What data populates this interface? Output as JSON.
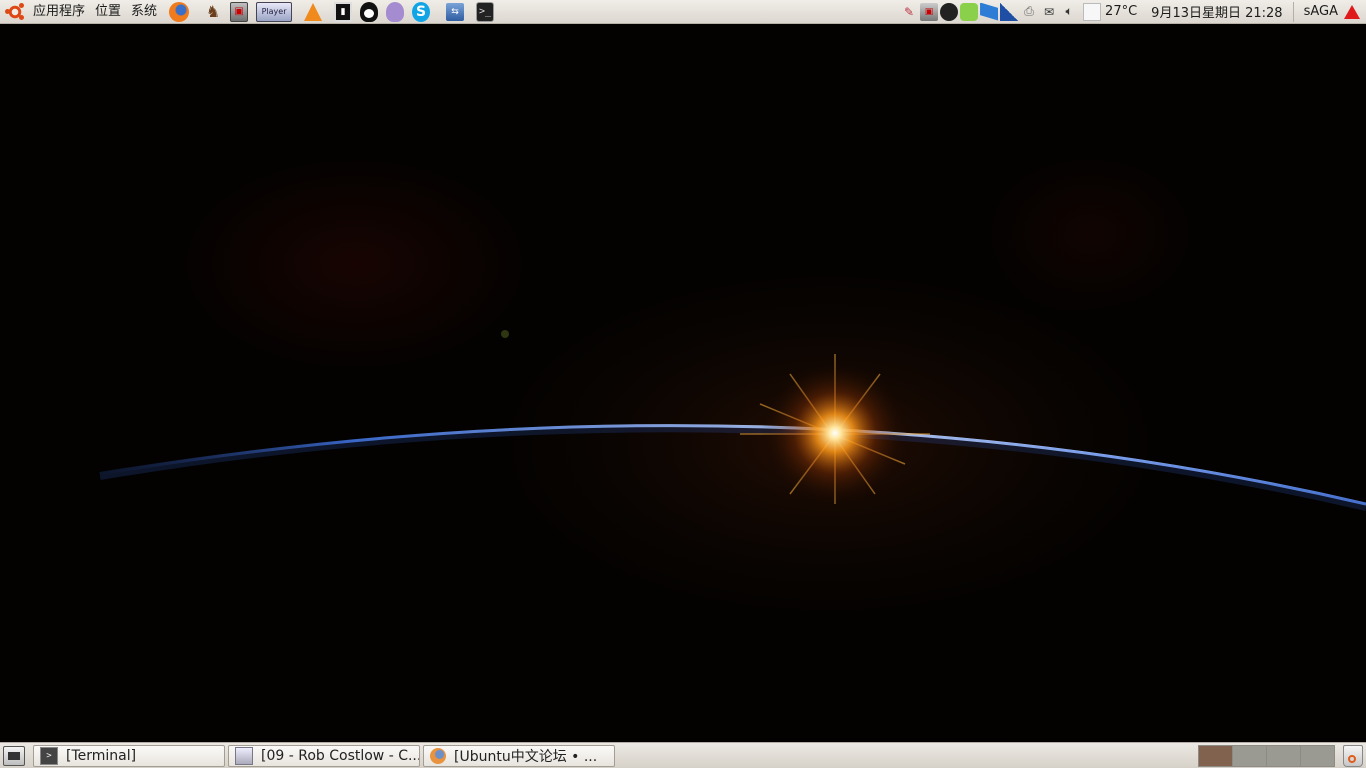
{
  "top_panel": {
    "menus": [
      "应用程序",
      "位置",
      "系统"
    ],
    "launchers": [
      "firefox-icon",
      "rabbit-icon",
      "box-icon",
      "media-player-icon",
      "vlc-icon",
      "tv-icon",
      "qq-icon",
      "qq-alt-icon",
      "skype-icon",
      "network-icon",
      "terminal-icon"
    ],
    "player_label": "Player",
    "tray_icons": [
      "firefox-tray-icon",
      "box-tray-icon",
      "qq-tray-icon",
      "green-tray-icon",
      "blue-tray-icon",
      "signal-icon",
      "printer-icon",
      "mail-icon",
      "volume-icon"
    ],
    "temperature": "27°C",
    "datetime": "9月13日星期日 21:28",
    "user": "sAGA"
  },
  "taskbar": {
    "tasks": [
      {
        "label": "[Terminal]",
        "icon": "terminal-icon"
      },
      {
        "label": "[09 - Rob Costlow - C...",
        "icon": "document-icon"
      },
      {
        "label": "[Ubuntu中文论坛 • ...",
        "icon": "firefox-icon"
      }
    ],
    "workspaces": 4,
    "active_workspace": 1
  },
  "colors": {
    "panel": "#dcd7cf",
    "accent": "#dd4814",
    "alert": "#e01a1a",
    "active_workspace": "#80624f"
  }
}
